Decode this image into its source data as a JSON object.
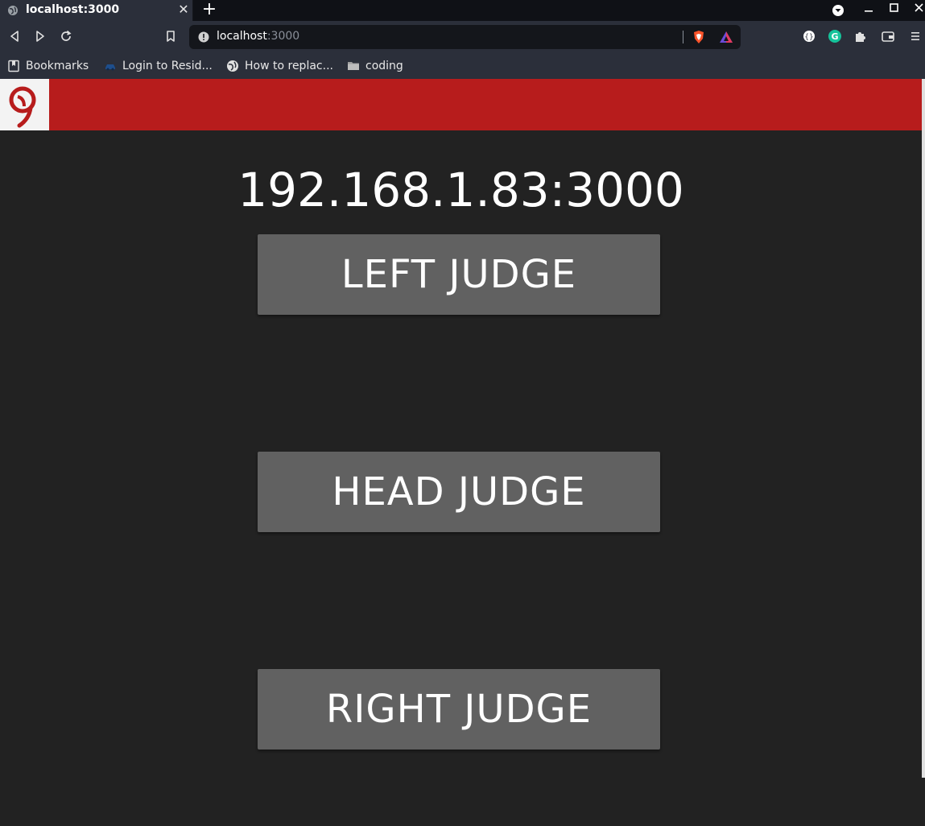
{
  "browser": {
    "tab": {
      "title": "localhost:3000",
      "close": "✕"
    },
    "new_tab": "+",
    "address_bar": {
      "host": "localhost",
      "port": ":3000"
    },
    "bookmarks": [
      {
        "label": "Bookmarks",
        "icon": "bookmarks-icon"
      },
      {
        "label": "Login to Resid...",
        "icon": "car-icon"
      },
      {
        "label": "How to replac...",
        "icon": "globe-icon"
      },
      {
        "label": "coding",
        "icon": "folder-icon"
      }
    ]
  },
  "page": {
    "header": {
      "brand_color": "#b71c1c",
      "logo": "nine-logo-icon"
    },
    "address": "192.168.1.83:3000",
    "buttons": {
      "left": "LEFT JUDGE",
      "head": "HEAD JUDGE",
      "right": "RIGHT JUDGE"
    }
  }
}
